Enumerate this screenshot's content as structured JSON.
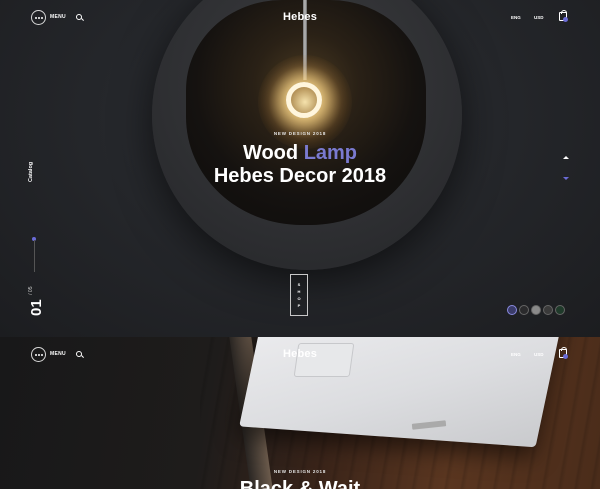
{
  "header": {
    "menu_label": "MENU",
    "logo": "Hebes",
    "language": "ENG",
    "currency": "USD"
  },
  "hero1": {
    "eyebrow": "NEW DESIGN 2018",
    "title_part1": "Wood",
    "title_accent": "Lamp",
    "title_line2": "Hebes Decor 2018",
    "catalog_label": "Catalog",
    "slide_current": "01",
    "slide_total": "/ 05",
    "shop_letters": [
      "S",
      "H",
      "O",
      "P"
    ],
    "thumbnail_count": 5
  },
  "hero2": {
    "eyebrow": "NEW DESIGN 2018",
    "title_partial": "Black & Wait"
  },
  "colors": {
    "accent": "#6a6bd6",
    "background": "#1a1a1c"
  },
  "icons": [
    "menu-dots-icon",
    "search-icon",
    "cart-icon",
    "arrow-up-icon",
    "arrow-down-icon",
    "chevron-right-icon"
  ]
}
